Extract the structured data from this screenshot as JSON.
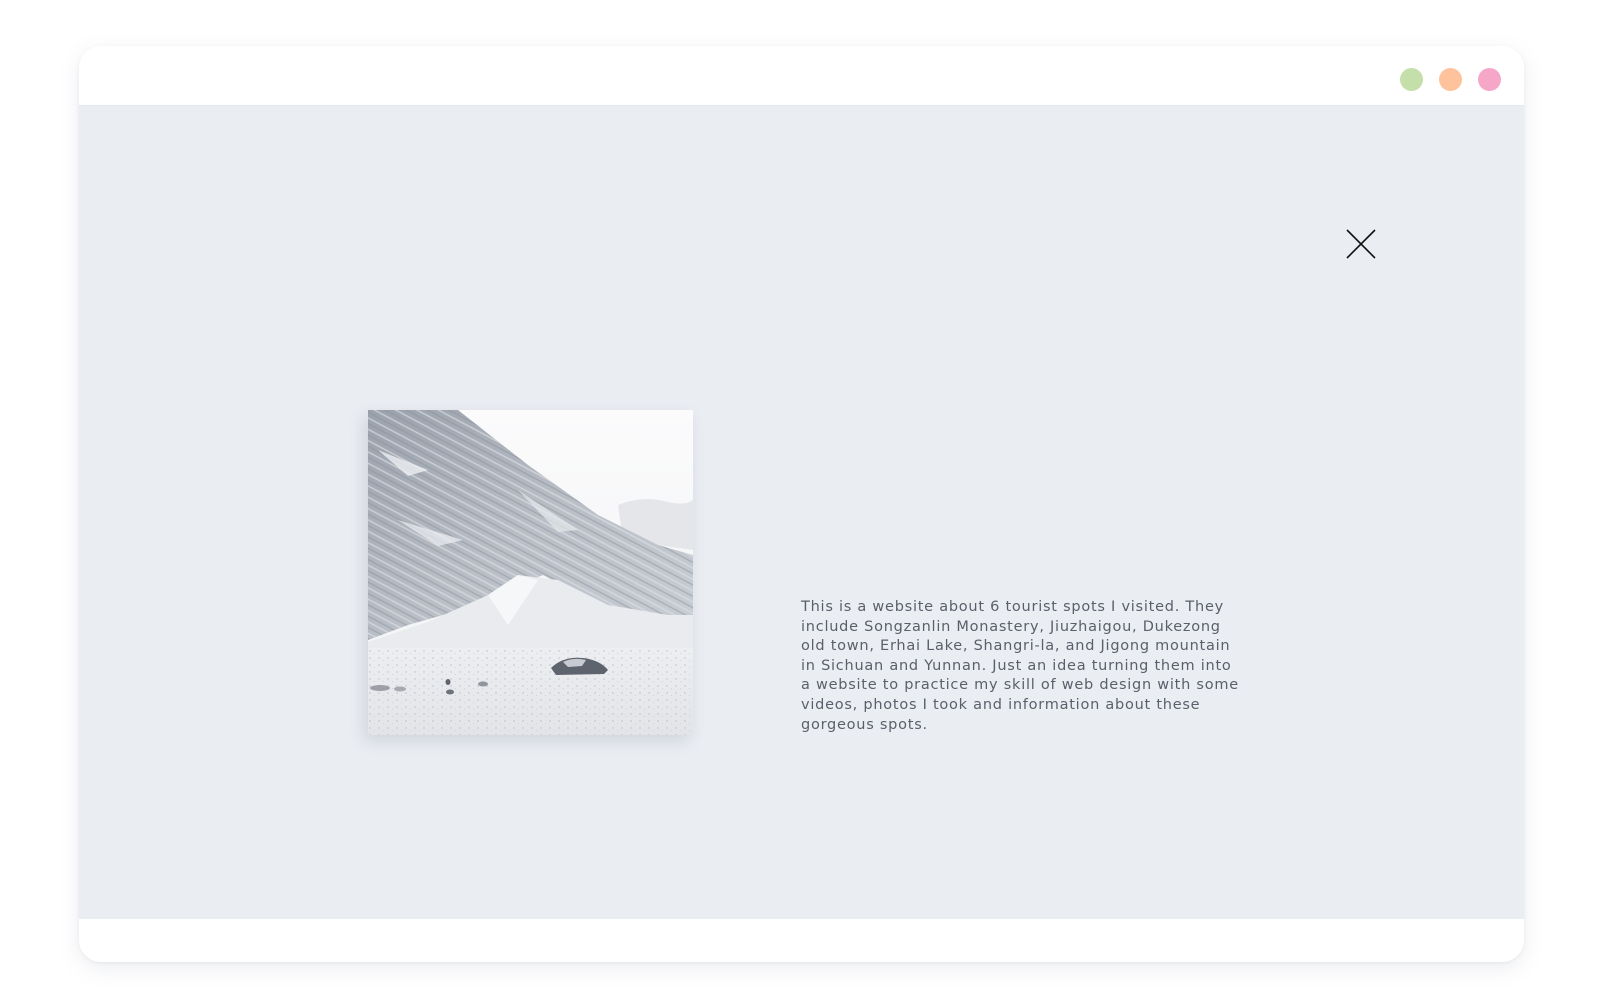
{
  "window": {
    "controls": [
      {
        "name": "green-dot",
        "color": "#c4dfa9"
      },
      {
        "name": "orange-dot",
        "color": "#fec29c"
      },
      {
        "name": "pink-dot",
        "color": "#f6a7c8"
      }
    ]
  },
  "modal": {
    "close_icon": "close-icon",
    "photo": {
      "subject": "snowy-mountain-photo"
    },
    "description": "This is a website about 6 tourist spots I visited. They include Songzanlin Monastery, Jiuzhaigou, Dukezong old town, Erhai Lake, Shangri-la, and Jigong mountain in Sichuan and Yunnan. Just an idea turning them into a website to practice my skill of web design with some videos, photos I took and information about these gorgeous spots."
  },
  "colors": {
    "background": "#eaedf2",
    "text": "#5a5f6a",
    "window": "#ffffff"
  }
}
